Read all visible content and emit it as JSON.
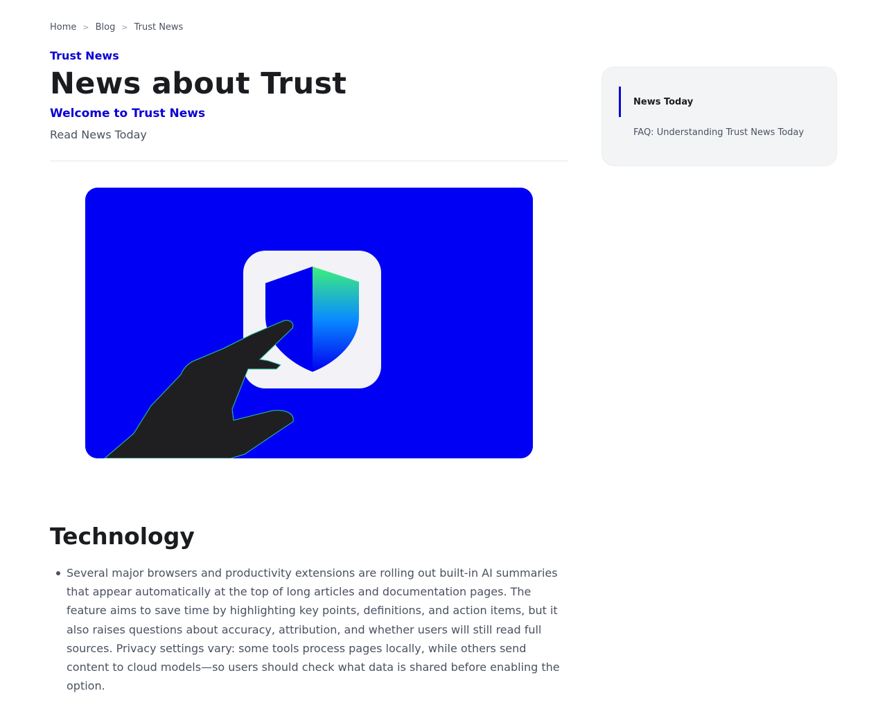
{
  "breadcrumb": {
    "items": [
      "Home",
      "Blog",
      "Trust News"
    ],
    "separator": ">"
  },
  "header": {
    "kicker": "Trust News",
    "title": "News about Trust",
    "subtitle": "Welcome to Trust News",
    "lead": "Read News Today"
  },
  "hero": {
    "background_color": "#0000f5",
    "icon": "shield-icon"
  },
  "section": {
    "title": "Technology",
    "bullets": [
      "Several major browsers and productivity extensions are rolling out built-in AI summaries that appear automatically at the top of long articles and documentation pages. The feature aims to save time by highlighting key points, definitions, and action items, but it also raises questions about accuracy, attribution, and whether users will still read full sources. Privacy settings vary: some tools process pages locally, while others send content to cloud models—so users should check what data is shared before enabling the option."
    ]
  },
  "toc": {
    "items": [
      {
        "label": "News Today",
        "active": true
      },
      {
        "label": "FAQ: Understanding Trust News Today",
        "active": false
      }
    ]
  },
  "colors": {
    "accent": "#0a00d4",
    "text": "#1a1c20",
    "muted": "#4a5160"
  }
}
